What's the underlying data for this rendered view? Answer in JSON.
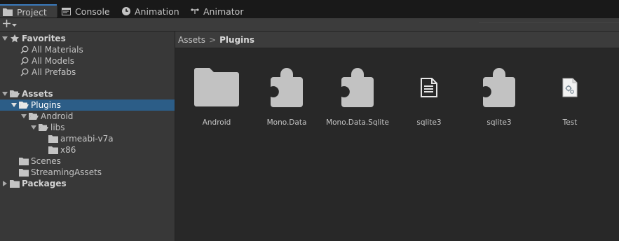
{
  "tabs": [
    {
      "label": "Project",
      "icon": "folder-icon",
      "active": true
    },
    {
      "label": "Console",
      "icon": "console-icon",
      "active": false
    },
    {
      "label": "Animation",
      "icon": "clock-icon",
      "active": false
    },
    {
      "label": "Animator",
      "icon": "animator-icon",
      "active": false
    }
  ],
  "toolbar": {
    "add_label": "+"
  },
  "tree": {
    "favorites": {
      "label": "Favorites",
      "items": [
        "All Materials",
        "All Models",
        "All Prefabs"
      ]
    },
    "assets": {
      "label": "Assets",
      "plugins": "Plugins",
      "android": "Android",
      "libs": "libs",
      "armeabi": "armeabi-v7a",
      "x86": "x86",
      "scenes": "Scenes",
      "streaming": "StreamingAssets"
    },
    "packages": {
      "label": "Packages"
    }
  },
  "breadcrumb": {
    "root": "Assets",
    "separator": ">",
    "current": "Plugins"
  },
  "assets_grid": [
    {
      "name": "Android",
      "icon": "folder-icon"
    },
    {
      "name": "Mono.Data",
      "icon": "plugin-icon"
    },
    {
      "name": "Mono.Data.Sqlite",
      "icon": "plugin-icon"
    },
    {
      "name": "sqlite3",
      "icon": "document-icon"
    },
    {
      "name": "sqlite3",
      "icon": "plugin-icon"
    },
    {
      "name": "Test",
      "icon": "script-file-icon"
    }
  ],
  "colors": {
    "selection": "#2c5d87",
    "tab_accent": "#3a79bb"
  }
}
